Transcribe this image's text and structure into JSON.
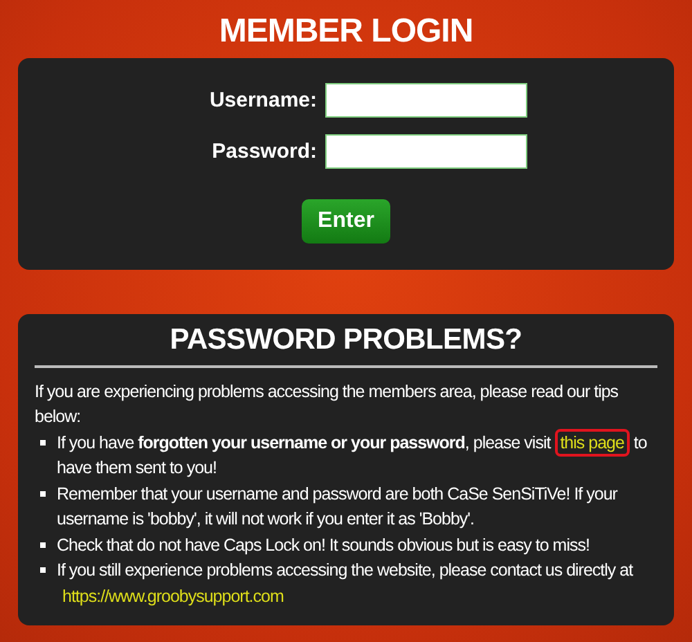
{
  "login": {
    "title": "MEMBER LOGIN",
    "fields": [
      {
        "label": "Username:"
      },
      {
        "label": "Password:"
      }
    ],
    "submit": "Enter"
  },
  "problems": {
    "title": "PASSWORD PROBLEMS?",
    "intro": "If you are experiencing problems accessing the members area, please read our tips below:",
    "tips": [
      {
        "text": "If you have **forgotten your username or your password**, please visit",
        "link": "this page",
        "link_highlighted": true,
        "after": "to have them sent to you!"
      },
      {
        "text": "Remember that your username and password are both CaSe SenSiTiVe! If your username is 'bobby', it will not work if you enter it as 'Bobby'."
      },
      {
        "text": "Check that do not have Caps Lock on! It sounds obvious but is easy to miss!"
      },
      {
        "text": "If you still experience problems accessing the website, please contact us directly at",
        "link": "https://www.groobysupport.com",
        "link_highlighted": false
      }
    ]
  }
}
